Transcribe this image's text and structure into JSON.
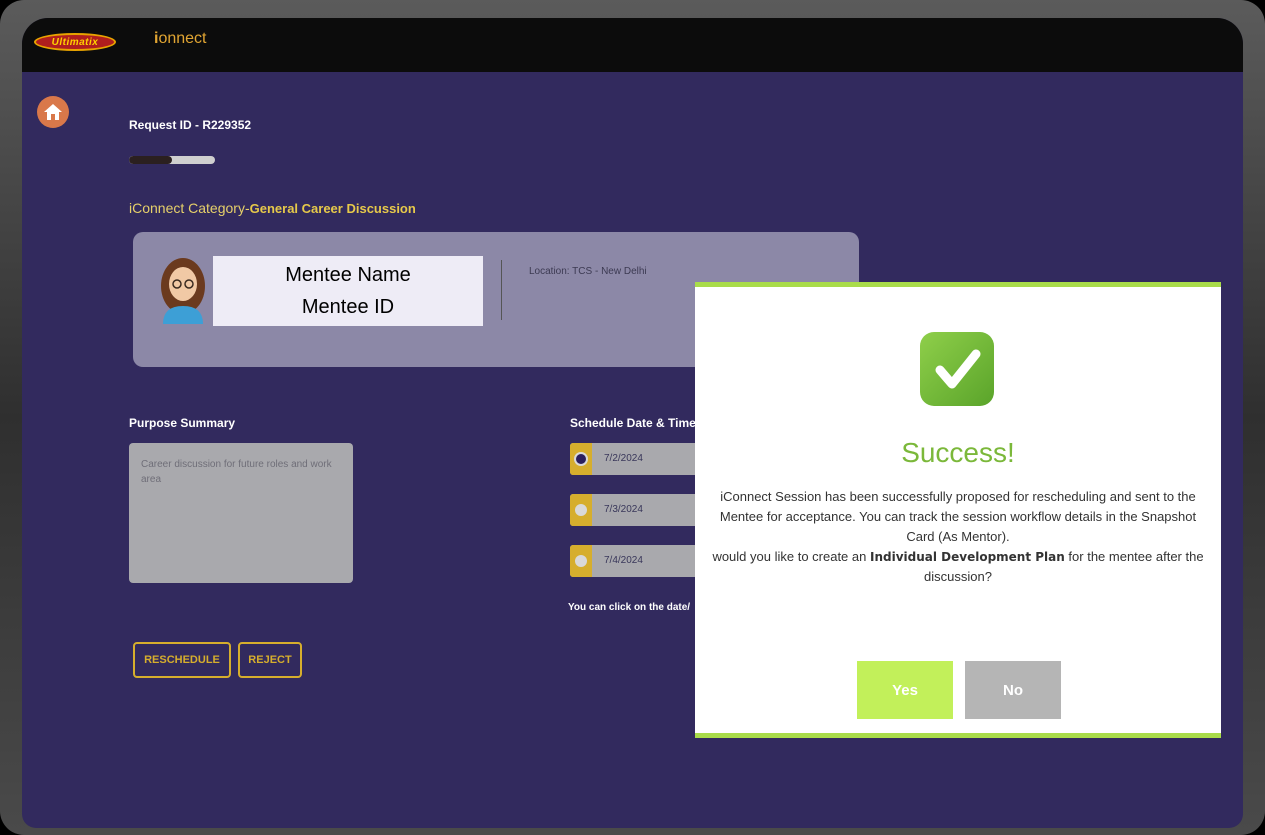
{
  "header": {
    "brand_logo": "Ultimatix",
    "app_logo_prefix": "i",
    "app_logo_suffix": "onnect"
  },
  "nav": {
    "home_icon": "home-icon"
  },
  "request": {
    "id_label": "Request ID - R229352",
    "progress_fraction": 0.5,
    "category_prefix": "iConnect Category-",
    "category_value": "General Career Discussion"
  },
  "mentee": {
    "name": "Mentee Name",
    "id": "Mentee ID",
    "location": "Location: TCS - New Delhi"
  },
  "purpose": {
    "label": "Purpose Summary",
    "text": "Career discussion for future roles and work area"
  },
  "schedule": {
    "label": "Schedule Date & Time",
    "options": [
      {
        "date": "7/2/2024",
        "selected": true
      },
      {
        "date": "7/3/2024",
        "selected": false
      },
      {
        "date": "7/4/2024",
        "selected": false
      }
    ],
    "hint": "You can click on the date/"
  },
  "actions": {
    "reschedule": "RESCHEDULE",
    "reject": "REJECT"
  },
  "modal": {
    "title": "Success!",
    "message_part1": "iConnect Session has been successfully proposed for rescheduling and sent to the Mentee for acceptance. You can track the session workflow details in the Snapshot Card (As Mentor).",
    "message_part2": "would you like to create an ",
    "message_bold": "Individual Development Plan",
    "message_part3": " for the mentee after the discussion?",
    "yes_label": "Yes",
    "no_label": "No"
  },
  "colors": {
    "background": "#322a5e",
    "accent_gold": "#d6ae2d",
    "success_green": "#7bb83a",
    "yes_button": "#c2f05a",
    "no_button": "#b5b5b5"
  }
}
